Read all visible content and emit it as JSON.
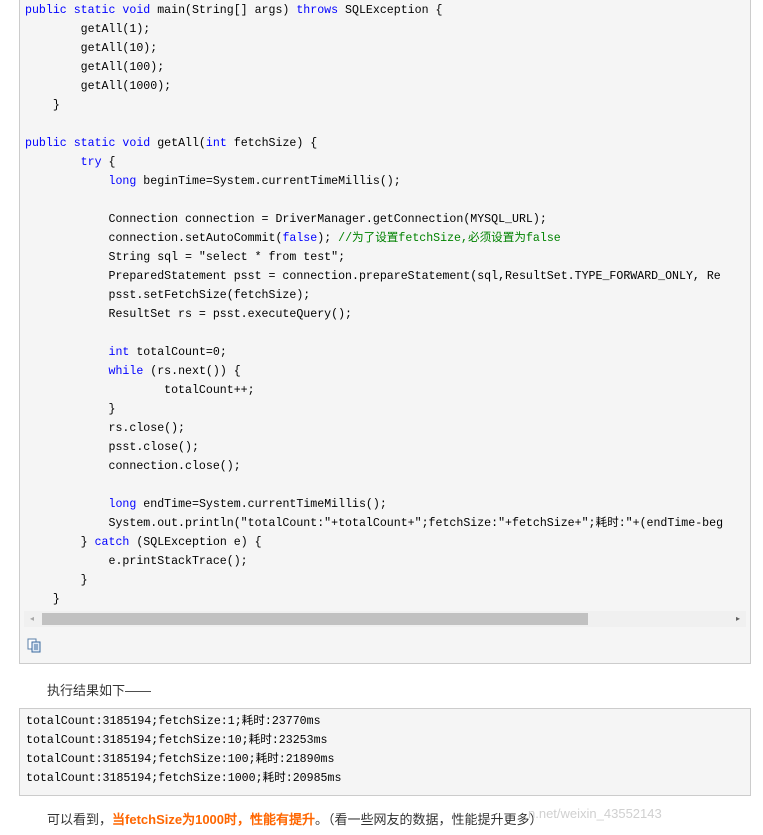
{
  "code_lines": [
    [
      {
        "t": "public static void",
        "c": "kw"
      },
      {
        "t": " main(String[] args) "
      },
      {
        "t": "throws",
        "c": "kw"
      },
      {
        "t": " SQLException {"
      }
    ],
    [
      {
        "t": "        getAll(1);"
      }
    ],
    [
      {
        "t": "        getAll(10);"
      }
    ],
    [
      {
        "t": "        getAll(100);"
      }
    ],
    [
      {
        "t": "        getAll(1000);"
      }
    ],
    [
      {
        "t": "    }"
      }
    ],
    [
      {
        "t": ""
      }
    ],
    [
      {
        "t": "public static void",
        "c": "kw"
      },
      {
        "t": " getAll("
      },
      {
        "t": "int",
        "c": "kw"
      },
      {
        "t": " fetchSize) {"
      }
    ],
    [
      {
        "t": "        "
      },
      {
        "t": "try",
        "c": "kw"
      },
      {
        "t": " {"
      }
    ],
    [
      {
        "t": "            "
      },
      {
        "t": "long",
        "c": "kw"
      },
      {
        "t": " beginTime=System.currentTimeMillis();"
      }
    ],
    [
      {
        "t": ""
      }
    ],
    [
      {
        "t": "            Connection connection = DriverManager.getConnection(MYSQL_URL);"
      }
    ],
    [
      {
        "t": "            connection.setAutoCommit("
      },
      {
        "t": "false",
        "c": "kw"
      },
      {
        "t": "); "
      },
      {
        "t": "//为了设置fetchSize,必须设置为false",
        "c": "cm"
      }
    ],
    [
      {
        "t": "            String sql = \"select * from test\";"
      }
    ],
    [
      {
        "t": "            PreparedStatement psst = connection.prepareStatement(sql,ResultSet.TYPE_FORWARD_ONLY, Re"
      }
    ],
    [
      {
        "t": "            psst.setFetchSize(fetchSize);"
      }
    ],
    [
      {
        "t": "            ResultSet rs = psst.executeQuery();"
      }
    ],
    [
      {
        "t": ""
      }
    ],
    [
      {
        "t": "            "
      },
      {
        "t": "int",
        "c": "kw"
      },
      {
        "t": " totalCount=0;"
      }
    ],
    [
      {
        "t": "            "
      },
      {
        "t": "while",
        "c": "kw"
      },
      {
        "t": " (rs.next()) {"
      }
    ],
    [
      {
        "t": "                    totalCount++;"
      }
    ],
    [
      {
        "t": "            }"
      }
    ],
    [
      {
        "t": "            rs.close();"
      }
    ],
    [
      {
        "t": "            psst.close();"
      }
    ],
    [
      {
        "t": "            connection.close();"
      }
    ],
    [
      {
        "t": ""
      }
    ],
    [
      {
        "t": "            "
      },
      {
        "t": "long",
        "c": "kw"
      },
      {
        "t": " endTime=System.currentTimeMillis();"
      }
    ],
    [
      {
        "t": "            System.out.println(\"totalCount:\"+totalCount+\";fetchSize:\"+fetchSize+\";耗时:\"+(endTime-beg"
      }
    ],
    [
      {
        "t": "        } "
      },
      {
        "t": "catch",
        "c": "kw"
      },
      {
        "t": " (SQLException e) {"
      }
    ],
    [
      {
        "t": "            e.printStackTrace();"
      }
    ],
    [
      {
        "t": "        }"
      }
    ],
    [
      {
        "t": "    }"
      }
    ]
  ],
  "scrollbar": {
    "left_arrow": "◂",
    "right_arrow": "▸"
  },
  "copy_icon": "copy-icon",
  "result_intro": "执行结果如下——",
  "output_lines": [
    "totalCount:3185194;fetchSize:1;耗时:23770ms",
    "totalCount:3185194;fetchSize:10;耗时:23253ms",
    "totalCount:3185194;fetchSize:100;耗时:21890ms",
    "totalCount:3185194;fetchSize:1000;耗时:20985ms"
  ],
  "conclusion": {
    "before": "可以看到，",
    "highlight": "当fetchSize为1000时，性能有提升",
    "after": "。（看一些网友的数据，性能提升更多）"
  },
  "watermark": "n.net/weixin_43552143",
  "colors": {
    "keyword": "#0000ff",
    "comment": "#008200",
    "highlight": "#ff6600"
  }
}
